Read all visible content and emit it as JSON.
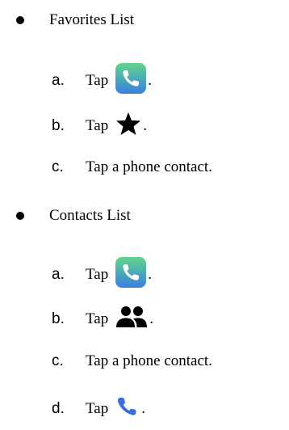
{
  "sections": [
    {
      "title": "Favorites List",
      "steps": [
        {
          "marker": "a.",
          "text": "Tap",
          "icon": "phone-app-icon",
          "suffix": "."
        },
        {
          "marker": "b.",
          "text": "Tap",
          "icon": "star-icon",
          "suffix": "."
        },
        {
          "marker": "c.",
          "text": "Tap a phone contact.",
          "icon": "",
          "suffix": ""
        }
      ]
    },
    {
      "title": "Contacts List",
      "steps": [
        {
          "marker": "a.",
          "text": "Tap",
          "icon": "phone-app-icon",
          "suffix": "."
        },
        {
          "marker": "b.",
          "text": "Tap",
          "icon": "contacts-people-icon",
          "suffix": "."
        },
        {
          "marker": "c.",
          "text": "Tap a phone contact.",
          "icon": "",
          "suffix": ""
        },
        {
          "marker": "d.",
          "text": "Tap",
          "icon": "phone-handset-icon",
          "suffix": "."
        }
      ]
    }
  ],
  "colors": {
    "phone_app_gradient_top": "#5fd68b",
    "phone_app_gradient_bottom": "#3a7fe0",
    "handset_blue": "#3a6fd9",
    "text": "#000000"
  }
}
